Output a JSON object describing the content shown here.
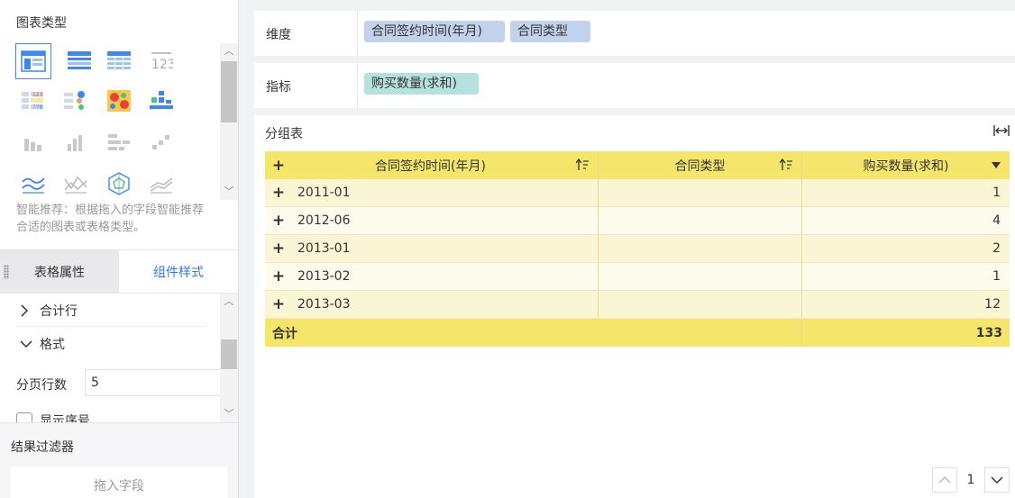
{
  "left": {
    "chart_type_title": "图表类型",
    "recommend_hint": "智能推荐：根据拖入的字段智能推荐合适的图表或表格类型。",
    "tabs": [
      {
        "label": "表格属性",
        "active": false
      },
      {
        "label": "组件样式",
        "active": true
      }
    ],
    "props": {
      "total_row_label": "合计行",
      "format_label": "格式",
      "page_rows_label": "分页行数",
      "page_rows_value": "5",
      "show_index_label": "显示序号"
    },
    "filter": {
      "title": "结果过滤器",
      "drop_placeholder": "拖入字段"
    }
  },
  "dimension": {
    "label": "维度",
    "fields": [
      "合同签约时间(年月)",
      "合同类型"
    ]
  },
  "measure": {
    "label": "指标",
    "fields": [
      "购买数量(求和)"
    ]
  },
  "table": {
    "title": "分组表",
    "columns": [
      "合同签约时间(年月)",
      "合同类型",
      "购买数量(求和)"
    ],
    "rows": [
      {
        "date": "2011-01",
        "type": "",
        "qty": "1"
      },
      {
        "date": "2012-06",
        "type": "",
        "qty": "4"
      },
      {
        "date": "2013-01",
        "type": "",
        "qty": "2"
      },
      {
        "date": "2013-02",
        "type": "",
        "qty": "1"
      },
      {
        "date": "2013-03",
        "type": "",
        "qty": "12"
      }
    ],
    "total_label": "合计",
    "total_value": "133"
  },
  "pager": {
    "page": "1"
  },
  "colors": {
    "accent": "#2c7be5",
    "header_yellow": "#f5e56b",
    "dimension_chip": "#c3d2ec",
    "measure_chip": "#b5e2de"
  }
}
